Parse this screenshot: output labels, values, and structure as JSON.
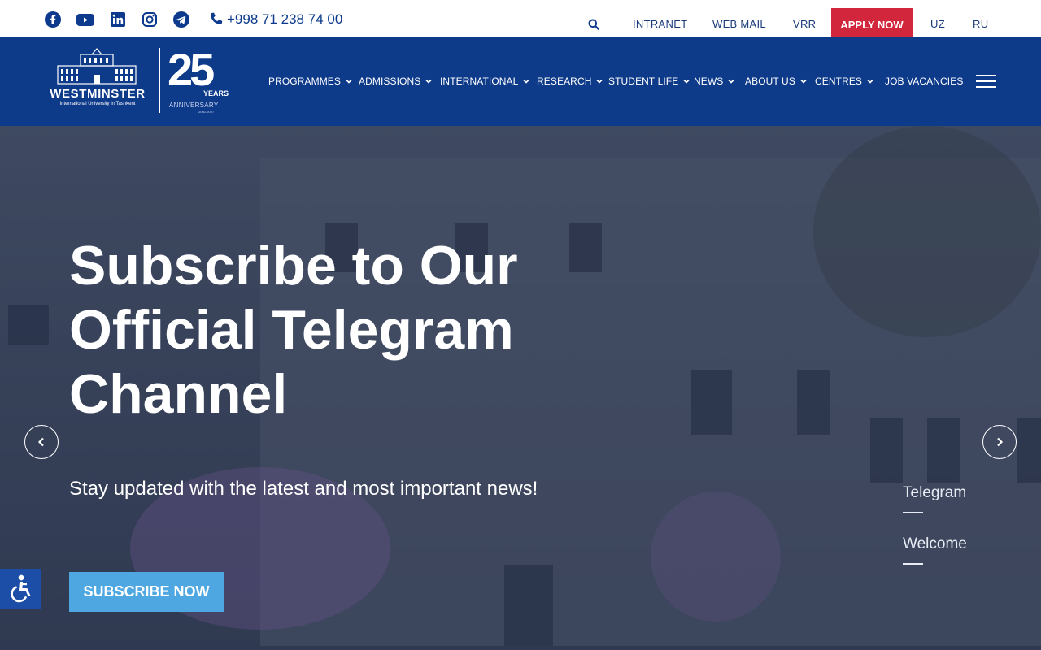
{
  "topbar": {
    "social": [
      "facebook-icon",
      "youtube-icon",
      "linkedin-icon",
      "instagram-icon",
      "telegram-icon"
    ],
    "phone": "+998 71 238 74 00",
    "links": {
      "intranet": "INTRANET",
      "webmail": "WEB MAIL",
      "vrr": "VRR",
      "apply": "APPLY NOW",
      "uz": "UZ",
      "ru": "RU"
    }
  },
  "logo": {
    "name": "WESTMINSTER",
    "subtitle": "International University in Tashkent",
    "number": "25",
    "years": "YEARS",
    "anniversary": "ANNIVERSARY",
    "dates": "2002-2027"
  },
  "nav": {
    "programmes": "PROGRAMMES",
    "admissions": "ADMISSIONS",
    "international": "INTERNATIONAL",
    "research": "RESEARCH",
    "student_life": "STUDENT LIFE",
    "news": "NEWS",
    "about": "ABOUT US",
    "centres": "CENTRES",
    "vacancies": "JOB VACANCIES"
  },
  "hero": {
    "title": "Subscribe to Our Official Telegram Channel",
    "subtitle": "Stay updated with the latest and most important news!",
    "button": "SUBSCRIBE NOW",
    "slides": [
      "Telegram",
      "Welcome"
    ]
  },
  "colors": {
    "brand_blue": "#0e3a8a",
    "apply_red": "#d1263b",
    "subscribe_blue": "#4ea7e0"
  }
}
